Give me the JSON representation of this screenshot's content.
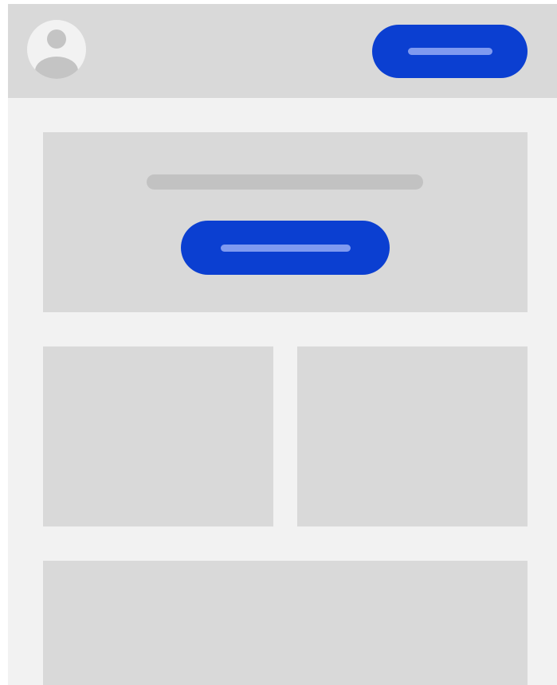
{
  "colors": {
    "page_background": "#f2f2f2",
    "placeholder_block": "#d9d9d9",
    "text_placeholder": "#c2c2c2",
    "primary_button": "#0b3fd1",
    "button_text_placeholder": "#7f9af0",
    "avatar_silhouette": "#c4c4c4",
    "avatar_background": "#f2f2f2"
  },
  "header": {
    "avatar_icon": "user-avatar-icon",
    "primary_button_label": ""
  },
  "hero": {
    "headline": "",
    "cta_label": ""
  },
  "content": {
    "tiles": [
      "",
      "",
      ""
    ]
  }
}
